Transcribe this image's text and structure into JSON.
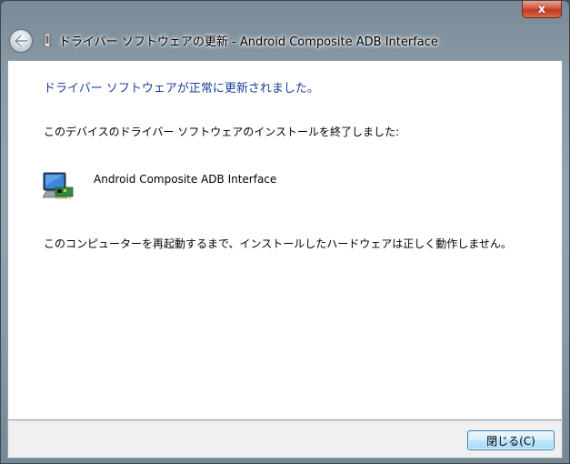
{
  "window": {
    "title": "ドライバー ソフトウェアの更新 - Android Composite ADB Interface",
    "close_glyph": "x"
  },
  "content": {
    "heading": "ドライバー ソフトウェアが正常に更新されました。",
    "description": "このデバイスのドライバー ソフトウェアのインストールを終了しました:",
    "device_name": "Android Composite ADB Interface",
    "note": "このコンピューターを再起動するまで、インストールしたハードウェアは正しく動作しません。"
  },
  "footer": {
    "close_label": "閉じる(C)"
  },
  "colors": {
    "heading": "#1b3f9d",
    "close_button_red": "#c03a22",
    "primary_button_border": "#3c7fb1"
  },
  "icons": {
    "back": "back-arrow-icon",
    "device": "usb-device-icon",
    "hardware": "computer-hardware-icon"
  }
}
